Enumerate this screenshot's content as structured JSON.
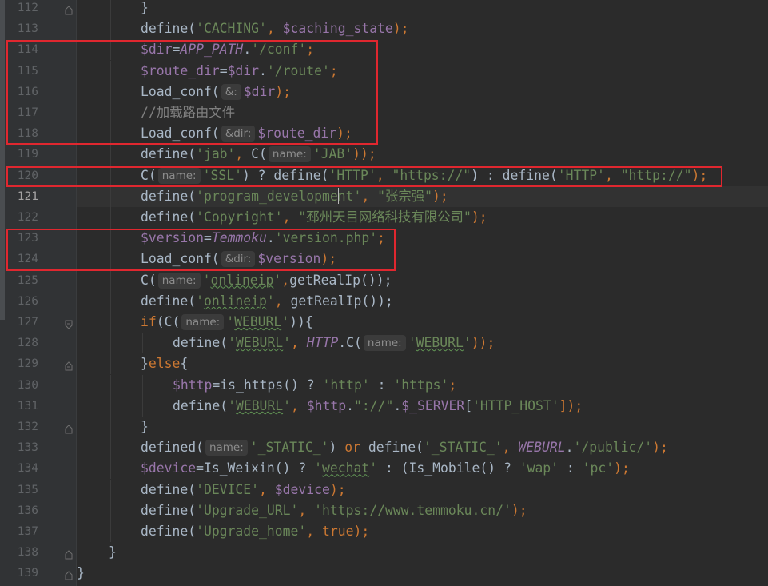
{
  "editor": {
    "current_line": 121,
    "lines": [
      {
        "n": "112",
        "indent": 2,
        "fold": "end",
        "tokens": [
          {
            "t": "}",
            "c": "plain"
          }
        ]
      },
      {
        "n": "113",
        "indent": 2,
        "tokens": [
          {
            "t": "define(",
            "c": "fn"
          },
          {
            "t": "'CACHING'",
            "c": "str"
          },
          {
            "t": ", ",
            "c": "pun"
          },
          {
            "t": "$caching_state",
            "c": "var"
          },
          {
            "t": ");",
            "c": "pun"
          }
        ]
      },
      {
        "n": "114",
        "indent": 2,
        "tokens": [
          {
            "t": "$dir",
            "c": "var"
          },
          {
            "t": "=",
            "c": "op"
          },
          {
            "t": "APP_PATH",
            "c": "const"
          },
          {
            "t": ".",
            "c": "op"
          },
          {
            "t": "'/conf'",
            "c": "str"
          },
          {
            "t": ";",
            "c": "pun"
          }
        ]
      },
      {
        "n": "115",
        "indent": 2,
        "tokens": [
          {
            "t": "$route_dir",
            "c": "var"
          },
          {
            "t": "=",
            "c": "op"
          },
          {
            "t": "$dir",
            "c": "var"
          },
          {
            "t": ".",
            "c": "op"
          },
          {
            "t": "'/route'",
            "c": "str"
          },
          {
            "t": ";",
            "c": "pun"
          }
        ]
      },
      {
        "n": "116",
        "indent": 2,
        "tokens": [
          {
            "t": "Load_conf(",
            "c": "fn"
          },
          {
            "hint": "&:"
          },
          {
            "t": "$dir",
            "c": "var"
          },
          {
            "t": ");",
            "c": "pun"
          }
        ]
      },
      {
        "n": "117",
        "indent": 2,
        "tokens": [
          {
            "t": "//加载路由文件",
            "c": "cmt"
          }
        ]
      },
      {
        "n": "118",
        "indent": 2,
        "tokens": [
          {
            "t": "Load_conf(",
            "c": "fn"
          },
          {
            "hint": "&dir:"
          },
          {
            "t": "$route_dir",
            "c": "var"
          },
          {
            "t": ");",
            "c": "pun"
          }
        ]
      },
      {
        "n": "119",
        "indent": 2,
        "tokens": [
          {
            "t": "define(",
            "c": "fn"
          },
          {
            "t": "'jab'",
            "c": "str"
          },
          {
            "t": ", ",
            "c": "pun"
          },
          {
            "t": "C(",
            "c": "fn"
          },
          {
            "hint": "name:"
          },
          {
            "t": "'JAB'",
            "c": "str"
          },
          {
            "t": "));",
            "c": "pun"
          }
        ]
      },
      {
        "n": "120",
        "indent": 2,
        "tokens": [
          {
            "t": "C(",
            "c": "fn"
          },
          {
            "hint": "name:"
          },
          {
            "t": "'SSL'",
            "c": "str"
          },
          {
            "t": ") ? ",
            "c": "op"
          },
          {
            "t": "define(",
            "c": "fn"
          },
          {
            "t": "'HTTP'",
            "c": "str"
          },
          {
            "t": ", ",
            "c": "pun"
          },
          {
            "t": "\"https://\"",
            "c": "str"
          },
          {
            "t": ") : ",
            "c": "op"
          },
          {
            "t": "define(",
            "c": "fn"
          },
          {
            "t": "'HTTP'",
            "c": "str"
          },
          {
            "t": ", ",
            "c": "pun"
          },
          {
            "t": "\"http://\"",
            "c": "str"
          },
          {
            "t": ");",
            "c": "pun"
          }
        ]
      },
      {
        "n": "121",
        "indent": 2,
        "tokens": [
          {
            "t": "define(",
            "c": "fn"
          },
          {
            "t": "'program_developme",
            "c": "str"
          },
          {
            "caret": true
          },
          {
            "t": "nt'",
            "c": "str"
          },
          {
            "t": ", ",
            "c": "pun"
          },
          {
            "t": "\"张宗强\"",
            "c": "str"
          },
          {
            "t": ");",
            "c": "pun"
          }
        ]
      },
      {
        "n": "122",
        "indent": 2,
        "tokens": [
          {
            "t": "define(",
            "c": "fn"
          },
          {
            "t": "'Copyright'",
            "c": "str"
          },
          {
            "t": ", ",
            "c": "pun"
          },
          {
            "t": "\"邳州天目网络科技有限公司\"",
            "c": "str"
          },
          {
            "t": ");",
            "c": "pun"
          }
        ]
      },
      {
        "n": "123",
        "indent": 2,
        "tokens": [
          {
            "t": "$version",
            "c": "var"
          },
          {
            "t": "=",
            "c": "op"
          },
          {
            "t": "Temmoku",
            "c": "const"
          },
          {
            "t": ".",
            "c": "op"
          },
          {
            "t": "'version.php'",
            "c": "str"
          },
          {
            "t": ";",
            "c": "pun"
          }
        ]
      },
      {
        "n": "124",
        "indent": 2,
        "tokens": [
          {
            "t": "Load_conf(",
            "c": "fn"
          },
          {
            "hint": "&dir:"
          },
          {
            "t": "$version",
            "c": "var"
          },
          {
            "t": ");",
            "c": "pun"
          }
        ]
      },
      {
        "n": "125",
        "indent": 2,
        "tokens": [
          {
            "t": "C(",
            "c": "fn"
          },
          {
            "hint": "name:"
          },
          {
            "t": "'",
            "c": "str"
          },
          {
            "t": "onlineip",
            "c": "str",
            "sq": true
          },
          {
            "t": "'",
            "c": "str"
          },
          {
            "t": ",",
            "c": "pun"
          },
          {
            "t": "getRealIp());",
            "c": "fn"
          }
        ]
      },
      {
        "n": "126",
        "indent": 2,
        "tokens": [
          {
            "t": "define(",
            "c": "fn"
          },
          {
            "t": "'",
            "c": "str"
          },
          {
            "t": "onlineip",
            "c": "str",
            "sq": true
          },
          {
            "t": "'",
            "c": "str"
          },
          {
            "t": ", ",
            "c": "pun"
          },
          {
            "t": "getRealIp());",
            "c": "fn"
          }
        ]
      },
      {
        "n": "127",
        "indent": 2,
        "fold": "start",
        "tokens": [
          {
            "t": "if",
            "c": "kw"
          },
          {
            "t": "(C(",
            "c": "fn"
          },
          {
            "hint": "name:"
          },
          {
            "t": "'",
            "c": "str"
          },
          {
            "t": "WEBURL",
            "c": "str",
            "sq": true
          },
          {
            "t": "'",
            "c": "str"
          },
          {
            "t": ")){",
            "c": "plain"
          }
        ]
      },
      {
        "n": "128",
        "indent": 3,
        "tokens": [
          {
            "t": "define(",
            "c": "fn"
          },
          {
            "t": "'",
            "c": "str"
          },
          {
            "t": "WEBURL",
            "c": "str",
            "sq": true
          },
          {
            "t": "'",
            "c": "str"
          },
          {
            "t": ", ",
            "c": "pun"
          },
          {
            "t": "HTTP",
            "c": "const"
          },
          {
            "t": ".C(",
            "c": "fn"
          },
          {
            "hint": "name:"
          },
          {
            "t": "'",
            "c": "str"
          },
          {
            "t": "WEBURL",
            "c": "str",
            "sq": true
          },
          {
            "t": "'",
            "c": "str"
          },
          {
            "t": "));",
            "c": "pun"
          }
        ]
      },
      {
        "n": "129",
        "indent": 2,
        "fold": "mid",
        "tokens": [
          {
            "t": "}",
            "c": "plain"
          },
          {
            "t": "else",
            "c": "kw"
          },
          {
            "t": "{",
            "c": "plain"
          }
        ]
      },
      {
        "n": "130",
        "indent": 3,
        "tokens": [
          {
            "t": "$http",
            "c": "var"
          },
          {
            "t": "=",
            "c": "op"
          },
          {
            "t": "is_https() ? ",
            "c": "fn"
          },
          {
            "t": "'http'",
            "c": "str"
          },
          {
            "t": " : ",
            "c": "op"
          },
          {
            "t": "'https'",
            "c": "str"
          },
          {
            "t": ";",
            "c": "pun"
          }
        ]
      },
      {
        "n": "131",
        "indent": 3,
        "tokens": [
          {
            "t": "define(",
            "c": "fn"
          },
          {
            "t": "'",
            "c": "str"
          },
          {
            "t": "WEBURL",
            "c": "str",
            "sq": true
          },
          {
            "t": "'",
            "c": "str"
          },
          {
            "t": ", ",
            "c": "pun"
          },
          {
            "t": "$http",
            "c": "var"
          },
          {
            "t": ".",
            "c": "op"
          },
          {
            "t": "\"://\"",
            "c": "str"
          },
          {
            "t": ".",
            "c": "op"
          },
          {
            "t": "$_SERVER",
            "c": "var"
          },
          {
            "t": "[",
            "c": "plain"
          },
          {
            "t": "'HTTP_HOST'",
            "c": "str"
          },
          {
            "t": "]);",
            "c": "pun"
          }
        ]
      },
      {
        "n": "132",
        "indent": 2,
        "fold": "end",
        "tokens": [
          {
            "t": "}",
            "c": "plain"
          }
        ]
      },
      {
        "n": "133",
        "indent": 2,
        "tokens": [
          {
            "t": "defined(",
            "c": "fn"
          },
          {
            "hint": "name:"
          },
          {
            "t": "'_STATIC_'",
            "c": "str"
          },
          {
            "t": ") ",
            "c": "plain"
          },
          {
            "t": "or",
            "c": "kw"
          },
          {
            "t": " define(",
            "c": "fn"
          },
          {
            "t": "'_STATIC_'",
            "c": "str"
          },
          {
            "t": ", ",
            "c": "pun"
          },
          {
            "t": "WEBURL",
            "c": "const"
          },
          {
            "t": ".",
            "c": "op"
          },
          {
            "t": "'/public/'",
            "c": "str"
          },
          {
            "t": ");",
            "c": "pun"
          }
        ]
      },
      {
        "n": "134",
        "indent": 2,
        "tokens": [
          {
            "t": "$device",
            "c": "var"
          },
          {
            "t": "=",
            "c": "op"
          },
          {
            "t": "Is_Weixin() ? ",
            "c": "fn"
          },
          {
            "t": "'",
            "c": "str"
          },
          {
            "t": "wechat",
            "c": "str",
            "sq": true
          },
          {
            "t": "'",
            "c": "str"
          },
          {
            "t": " : (Is_Mobile() ? ",
            "c": "fn"
          },
          {
            "t": "'wap'",
            "c": "str"
          },
          {
            "t": " : ",
            "c": "op"
          },
          {
            "t": "'pc'",
            "c": "str"
          },
          {
            "t": ");",
            "c": "pun"
          }
        ]
      },
      {
        "n": "135",
        "indent": 2,
        "tokens": [
          {
            "t": "define(",
            "c": "fn"
          },
          {
            "t": "'DEVICE'",
            "c": "str"
          },
          {
            "t": ", ",
            "c": "pun"
          },
          {
            "t": "$device",
            "c": "var"
          },
          {
            "t": ");",
            "c": "pun"
          }
        ]
      },
      {
        "n": "136",
        "indent": 2,
        "tokens": [
          {
            "t": "define(",
            "c": "fn"
          },
          {
            "t": "'Upgrade_URL'",
            "c": "str"
          },
          {
            "t": ", ",
            "c": "pun"
          },
          {
            "t": "'https://www.temmoku.cn/'",
            "c": "str"
          },
          {
            "t": ");",
            "c": "pun"
          }
        ]
      },
      {
        "n": "137",
        "indent": 2,
        "tokens": [
          {
            "t": "define(",
            "c": "fn"
          },
          {
            "t": "'Upgrade_home'",
            "c": "str"
          },
          {
            "t": ", ",
            "c": "pun"
          },
          {
            "t": "true",
            "c": "kw"
          },
          {
            "t": ");",
            "c": "pun"
          }
        ]
      },
      {
        "n": "138",
        "indent": 1,
        "fold": "end",
        "tokens": [
          {
            "t": "}",
            "c": "plain"
          }
        ]
      },
      {
        "n": "139",
        "indent": 0,
        "fold": "end",
        "tokens": [
          {
            "t": "}",
            "c": "plain"
          }
        ]
      }
    ]
  },
  "highlights": [
    {
      "from": "114",
      "to": "118"
    },
    {
      "from": "120",
      "to": "120"
    },
    {
      "from": "123",
      "to": "124"
    }
  ],
  "colors": {
    "background": "#2b2b2b",
    "gutter": "#313335",
    "highlight_box": "#e0272f",
    "keyword": "#cc7832",
    "string": "#6a8759",
    "variable": "#9876aa",
    "comment": "#808080",
    "text": "#a9b7c6"
  }
}
